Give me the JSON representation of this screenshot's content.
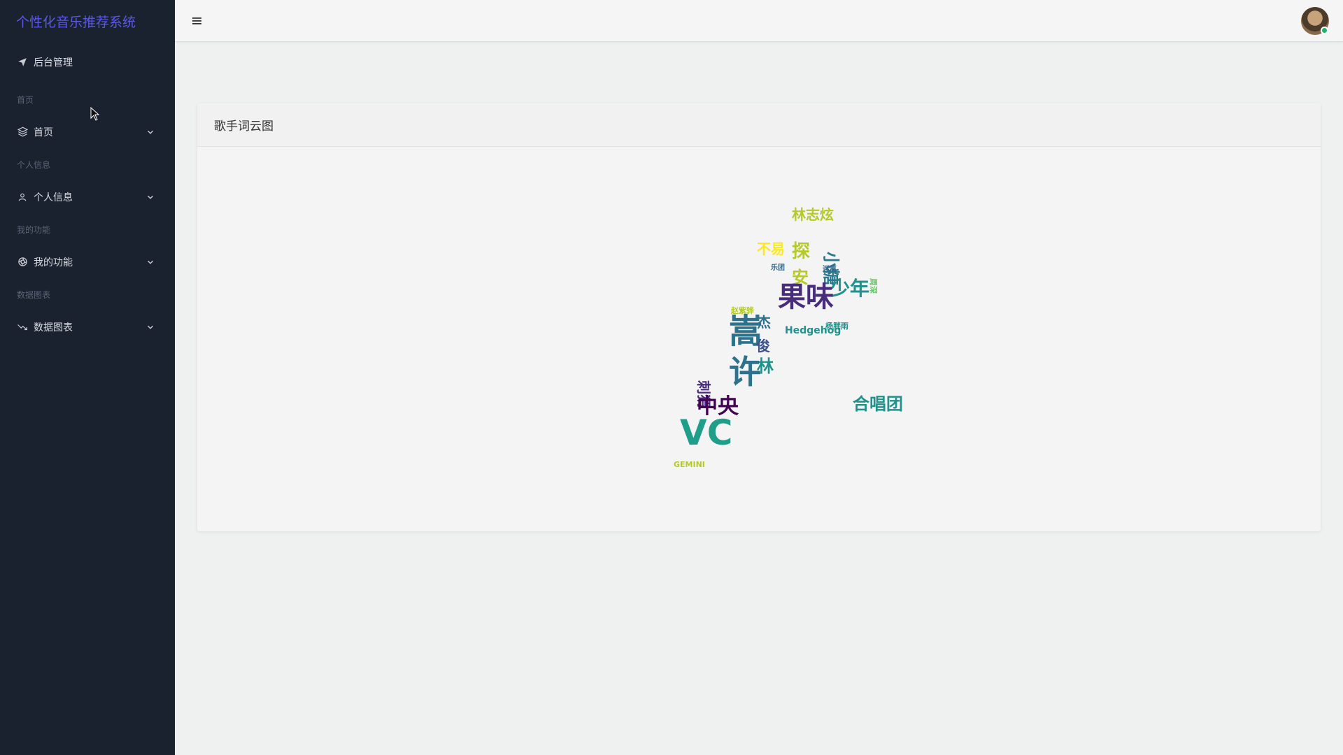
{
  "app": {
    "title": "个性化音乐推荐系统"
  },
  "sidebar": {
    "top_item": {
      "label": "后台管理",
      "icon": "send-icon"
    },
    "groups": [
      {
        "heading": "首页",
        "label": "首页",
        "icon": "layers-icon"
      },
      {
        "heading": "个人信息",
        "label": "个人信息",
        "icon": "user-icon"
      },
      {
        "heading": "我的功能",
        "label": "我的功能",
        "icon": "aperture-icon"
      },
      {
        "heading": "数据图表",
        "label": "数据图表",
        "icon": "trending-down-icon"
      }
    ]
  },
  "header": {
    "menu_icon": "menu-icon",
    "avatar_status_color": "#23b26d"
  },
  "card": {
    "title": "歌手词云图"
  },
  "wordcloud": [
    {
      "text": "林志炫",
      "color": "#b5c92a",
      "rotate": false
    },
    {
      "text": "小糖",
      "color": "#2a788e",
      "rotate": true
    },
    {
      "text": "不易",
      "color": "#fde725",
      "rotate": false
    },
    {
      "text": "探",
      "color": "#b5c92a",
      "rotate": false
    },
    {
      "text": "乐团",
      "color": "#31688e",
      "rotate": false
    },
    {
      "text": "迷离",
      "color": "#31688e",
      "rotate": false
    },
    {
      "text": "周深",
      "color": "#5ec962",
      "rotate": true
    },
    {
      "text": "安",
      "color": "#b5c92a",
      "rotate": false
    },
    {
      "text": "少年",
      "color": "#21918c",
      "rotate": false
    },
    {
      "text": "果味",
      "color": "#472d7b",
      "rotate": false
    },
    {
      "text": "赵紫骅",
      "color": "#b5c92a",
      "rotate": false
    },
    {
      "text": "嵩",
      "color": "#2c728e",
      "rotate": false
    },
    {
      "text": "杰",
      "color": "#2c728e",
      "rotate": false
    },
    {
      "text": "Hedgehog",
      "color": "#21918c",
      "rotate": false
    },
    {
      "text": "杨胖雨",
      "color": "#21918c",
      "rotate": false
    },
    {
      "text": "俊",
      "color": "#3b528b",
      "rotate": false
    },
    {
      "text": "林",
      "color": "#21918c",
      "rotate": false
    },
    {
      "text": "许",
      "color": "#2c728e",
      "rotate": false
    },
    {
      "text": "刺猬",
      "color": "#472d7b",
      "rotate": true
    },
    {
      "text": "中央",
      "color": "#440154",
      "rotate": false
    },
    {
      "text": "合唱团",
      "color": "#21918c",
      "rotate": false
    },
    {
      "text": "VC",
      "color": "#1f9e89",
      "rotate": false
    },
    {
      "text": "GEMINI",
      "color": "#b5c92a",
      "rotate": false
    }
  ]
}
